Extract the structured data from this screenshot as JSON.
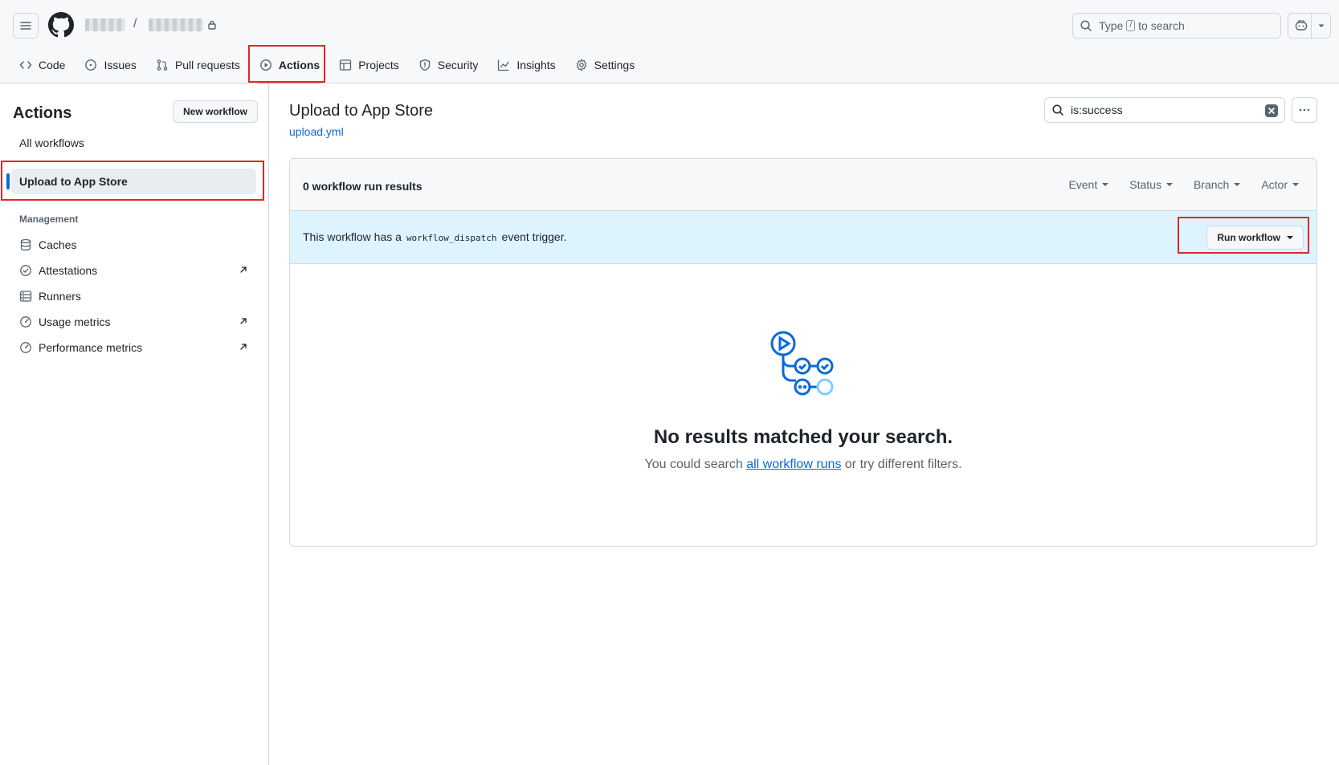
{
  "repo_nav": {
    "items": [
      {
        "label": "Code",
        "icon": "code-icon"
      },
      {
        "label": "Issues",
        "icon": "issue-icon"
      },
      {
        "label": "Pull requests",
        "icon": "pull-request-icon"
      },
      {
        "label": "Actions",
        "icon": "play-icon",
        "selected": true
      },
      {
        "label": "Projects",
        "icon": "table-icon"
      },
      {
        "label": "Security",
        "icon": "shield-icon"
      },
      {
        "label": "Insights",
        "icon": "graph-icon"
      },
      {
        "label": "Settings",
        "icon": "gear-icon"
      }
    ]
  },
  "header": {
    "breadcrumb_separator": "/",
    "search_prefix": "Type",
    "search_key": "/",
    "search_suffix": "to search"
  },
  "sidebar": {
    "title": "Actions",
    "new_workflow_label": "New workflow",
    "all_workflows_label": "All workflows",
    "selected_workflow": "Upload to App Store",
    "management_heading": "Management",
    "management_items": [
      {
        "label": "Caches",
        "icon": "database-icon",
        "external": false
      },
      {
        "label": "Attestations",
        "icon": "verified-icon",
        "external": true
      },
      {
        "label": "Runners",
        "icon": "server-icon",
        "external": false
      },
      {
        "label": "Usage metrics",
        "icon": "meter-icon",
        "external": true
      },
      {
        "label": "Performance metrics",
        "icon": "meter-icon",
        "external": true
      }
    ]
  },
  "main": {
    "workflow_title": "Upload to App Store",
    "workflow_file": "upload.yml",
    "filter_value": "is:success",
    "results_count": "0 workflow run results",
    "filters": [
      "Event",
      "Status",
      "Branch",
      "Actor"
    ],
    "banner_prefix": "This workflow has a",
    "banner_code": "workflow_dispatch",
    "banner_suffix": "event trigger.",
    "run_workflow_label": "Run workflow",
    "empty_title": "No results matched your search.",
    "empty_prefix": "You could search",
    "empty_link": "all workflow runs",
    "empty_suffix": "or try different filters."
  },
  "colors": {
    "accent": "#0969da",
    "highlight_box": "#e5252a",
    "banner_bg": "#ddf4ff",
    "selected_underline": "#fd8c73"
  }
}
